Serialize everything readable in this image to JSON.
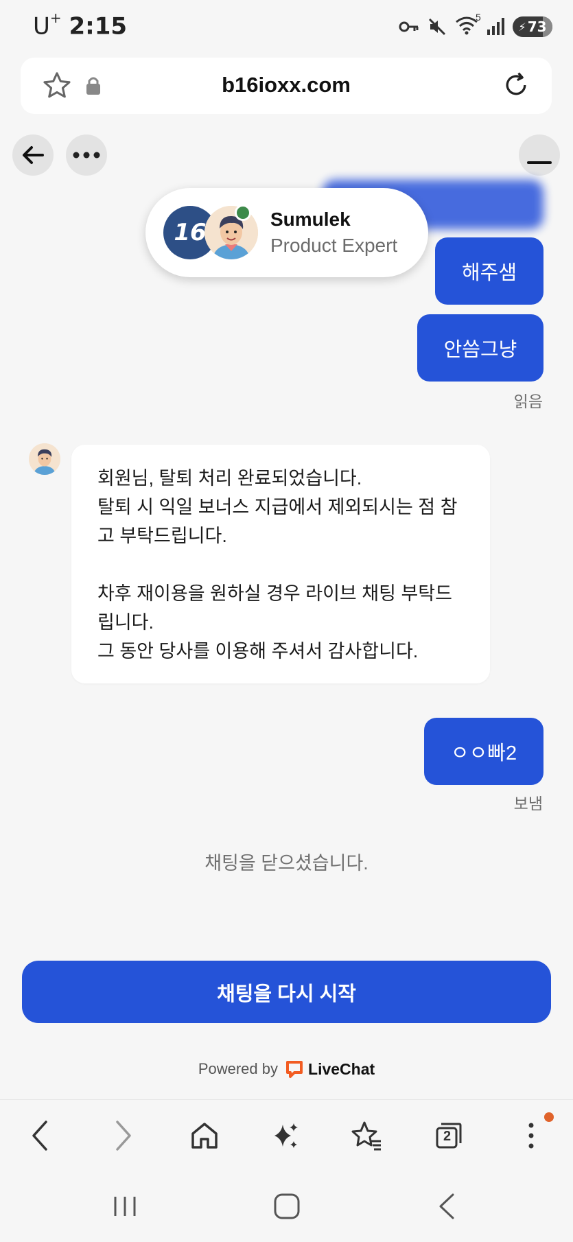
{
  "status_bar": {
    "carrier": "U",
    "carrier_plus": "+",
    "time": "2:15",
    "wifi_badge": "5",
    "battery_level": "73"
  },
  "browser": {
    "url": "b16ioxx.com",
    "tabs_count": "2"
  },
  "agent": {
    "logo_text": "16",
    "name": "Sumulek",
    "role": "Product Expert"
  },
  "messages": {
    "out_1": "해주샘",
    "out_2": "안씀그냥",
    "out_2_status": "읽음",
    "in_1": "회원님, 탈퇴 처리 완료되었습니다.\n탈퇴 시 익일 보너스 지급에서 제외되시는 점 참고 부탁드립니다.\n\n차후 재이용을 원하실 경우 라이브 채팅 부탁드립니다.\n그 동안 당사를 이용해 주셔서 감사합니다.",
    "out_3": "ㅇㅇ빠2",
    "out_3_status": "보냄"
  },
  "chat_closed_note": "채팅을 닫으셨습니다.",
  "restart_button": "채팅을 다시 시작",
  "powered_by": {
    "prefix": "Powered by",
    "brand": "LiveChat"
  },
  "colors": {
    "accent": "#2553d8",
    "online": "#3d8a4a",
    "notification": "#e0632b"
  }
}
